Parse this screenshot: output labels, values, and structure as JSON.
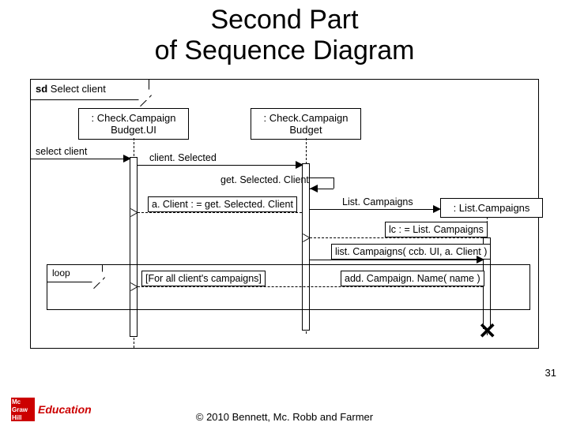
{
  "title_line1": "Second Part",
  "title_line2": "of Sequence Diagram",
  "frame_label_prefix": "sd",
  "frame_label_name": "Select client",
  "lifelines": {
    "ui": ": Check.Campaign\nBudget.UI",
    "budget": ": Check.Campaign\nBudget",
    "list": ": List.Campaigns"
  },
  "messages": {
    "select_client": "select client",
    "client_selected": "client. Selected",
    "get_selected_client": "get. Selected. Client",
    "a_client_assign": "a. Client : = get. Selected. Client",
    "list_campaigns_create": "List. Campaigns",
    "lc_assign": "lc : = List. Campaigns",
    "list_campaigns_call": "list. Campaigns( ccb. UI, a. Client )",
    "loop_guard": "[For all client's campaigns]",
    "add_campaign_name": "add. Campaign. Name( name )"
  },
  "loop_label": "loop",
  "footer": "© 2010 Bennett, Mc. Robb and Farmer",
  "page_number": "31",
  "logo_lines": "Mc\nGraw\nHill",
  "logo_brand": "Education"
}
